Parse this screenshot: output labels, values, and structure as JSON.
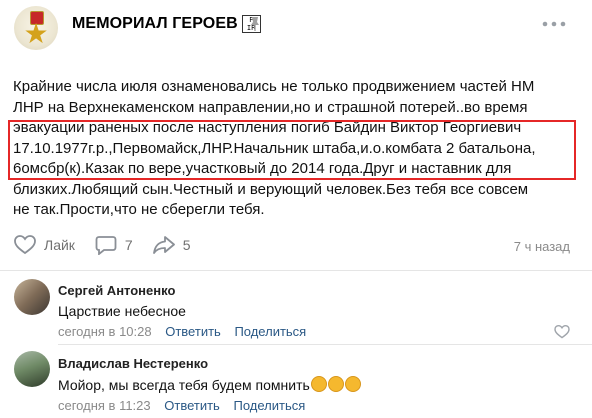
{
  "group": {
    "title": "МЕМОРИАЛ ГЕРОЕВ",
    "fire_glyph": "FIR"
  },
  "post": {
    "text_lines": [
      "Крайние числа июля ознаменовались не только продвижением частей НМ",
      "ЛНР на Верхнекаменском направлении,но и страшной потерей..во время",
      "эвакуации раненых после наступления погиб Байдин Виктор Георгиевич",
      "17.10.1977г.р.,Первомайск,ЛНР.Начальник штаба,и.о.комбата 2 батальона,",
      "6омсбр(к).Казак по вере,участковый до 2014 года.Друг и наставник для",
      "близких.Любящий сын.Честный и верующий человек.Без тебя все совсем",
      "не так.Прости,что не сберегли тебя."
    ]
  },
  "actions": {
    "like_label": "Лайк",
    "comments_count": "7",
    "shares_count": "5",
    "time": "7 ч назад"
  },
  "comments": [
    {
      "author": "Сергей Антоненко",
      "text": "Царствие небесное",
      "time": "сегодня в 10:28",
      "reply_label": "Ответить",
      "share_label": "Поделиться"
    },
    {
      "author": "Владислав Нестеренко",
      "text": "Мойор, мы всегда тебя будем помнить",
      "time": "сегодня в 11:23",
      "reply_label": "Ответить",
      "share_label": "Поделиться"
    }
  ],
  "colors": {
    "highlight": "#e52727",
    "link": "#2a5885",
    "muted": "#8a8a8a"
  }
}
